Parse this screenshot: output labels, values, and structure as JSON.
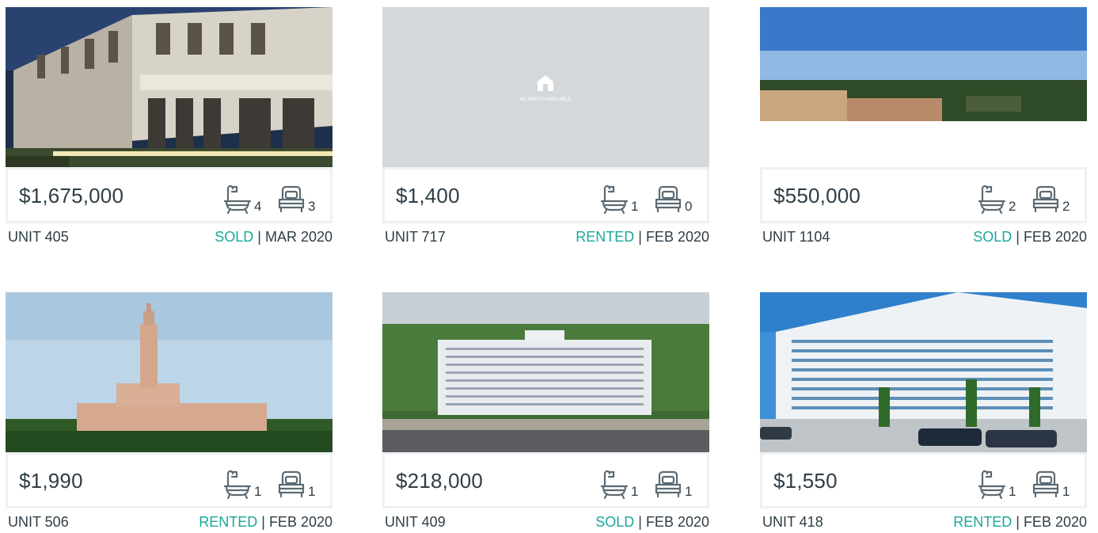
{
  "colors": {
    "accent": "#1aa79b",
    "text": "#2f3d46",
    "border": "#eef1f4"
  },
  "icons": {
    "bath": "bathtub-icon",
    "bed": "bed-icon",
    "no_photo": "house-icon"
  },
  "listings": [
    {
      "price": "$1,675,000",
      "baths": "4",
      "beds": "3",
      "unit": "UNIT 405",
      "status": "SOLD",
      "date": "MAR 2020",
      "photo": "building-night"
    },
    {
      "price": "$1,400",
      "baths": "1",
      "beds": "0",
      "unit": "UNIT 717",
      "status": "RENTED",
      "date": "FEB 2020",
      "photo": "none",
      "no_photo_text": "NO PHOTO AVAILABLE"
    },
    {
      "price": "$550,000",
      "baths": "2",
      "beds": "2",
      "unit": "UNIT 1104",
      "status": "SOLD",
      "date": "FEB 2020",
      "photo": "panorama"
    },
    {
      "price": "$1,990",
      "baths": "1",
      "beds": "1",
      "unit": "UNIT 506",
      "status": "RENTED",
      "date": "FEB 2020",
      "photo": "tower"
    },
    {
      "price": "$218,000",
      "baths": "1",
      "beds": "1",
      "unit": "UNIT 409",
      "status": "SOLD",
      "date": "FEB 2020",
      "photo": "aerial"
    },
    {
      "price": "$1,550",
      "baths": "1",
      "beds": "1",
      "unit": "UNIT 418",
      "status": "RENTED",
      "date": "FEB 2020",
      "photo": "highrise"
    }
  ]
}
